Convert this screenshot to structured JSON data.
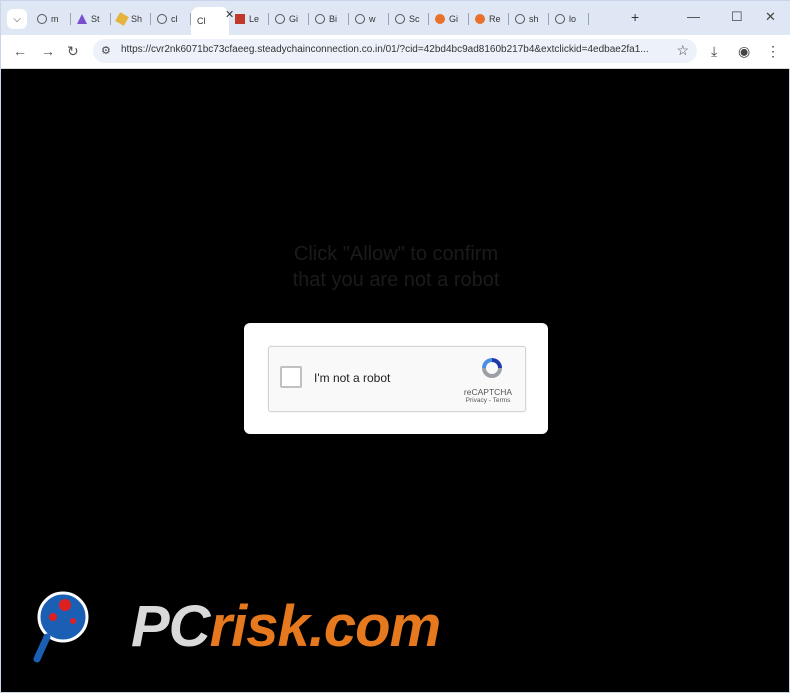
{
  "tabs": [
    {
      "label": "m",
      "icon": "search-tab-icon",
      "fav": "search"
    },
    {
      "label": "St",
      "icon": "tab-favicon",
      "fav": "purple"
    },
    {
      "label": "Sh",
      "icon": "tab-favicon",
      "fav": "yellow"
    },
    {
      "label": "cl",
      "icon": "globe-icon",
      "fav": "globe"
    },
    {
      "label": "Cl",
      "icon": "",
      "fav": "",
      "active": true
    },
    {
      "label": "Le",
      "icon": "tab-favicon",
      "fav": "red"
    },
    {
      "label": "Gi",
      "icon": "globe-icon",
      "fav": "globe"
    },
    {
      "label": "Bi",
      "icon": "globe-icon",
      "fav": "globe"
    },
    {
      "label": "w",
      "icon": "globe-icon",
      "fav": "globe"
    },
    {
      "label": "Sc",
      "icon": "globe-icon",
      "fav": "globe"
    },
    {
      "label": "Gi",
      "icon": "tab-favicon",
      "fav": "orange"
    },
    {
      "label": "Re",
      "icon": "tab-favicon",
      "fav": "orange"
    },
    {
      "label": "sh",
      "icon": "globe-icon",
      "fav": "globe"
    },
    {
      "label": "lo",
      "icon": "globe-icon",
      "fav": "globe"
    }
  ],
  "toolbar": {
    "url": "https://cvr2nk6071bc73cfaeeg.steadychainconnection.co.in/01/?cid=42bd4bc9ad8160b217b4&extclickid=4edbae2fa1..."
  },
  "page": {
    "headline_line1": "Click \"Allow\" to confirm",
    "headline_line2": "that you are not a robot"
  },
  "captcha": {
    "label": "I'm not a robot",
    "brand": "reCAPTCHA",
    "links": "Privacy - Terms"
  },
  "watermark": {
    "pc": "PC",
    "risk": "risk.com"
  },
  "colors": {
    "tabstrip": "#dfe7f5",
    "page_bg": "#000000",
    "watermark_orange": "#e6781e"
  }
}
